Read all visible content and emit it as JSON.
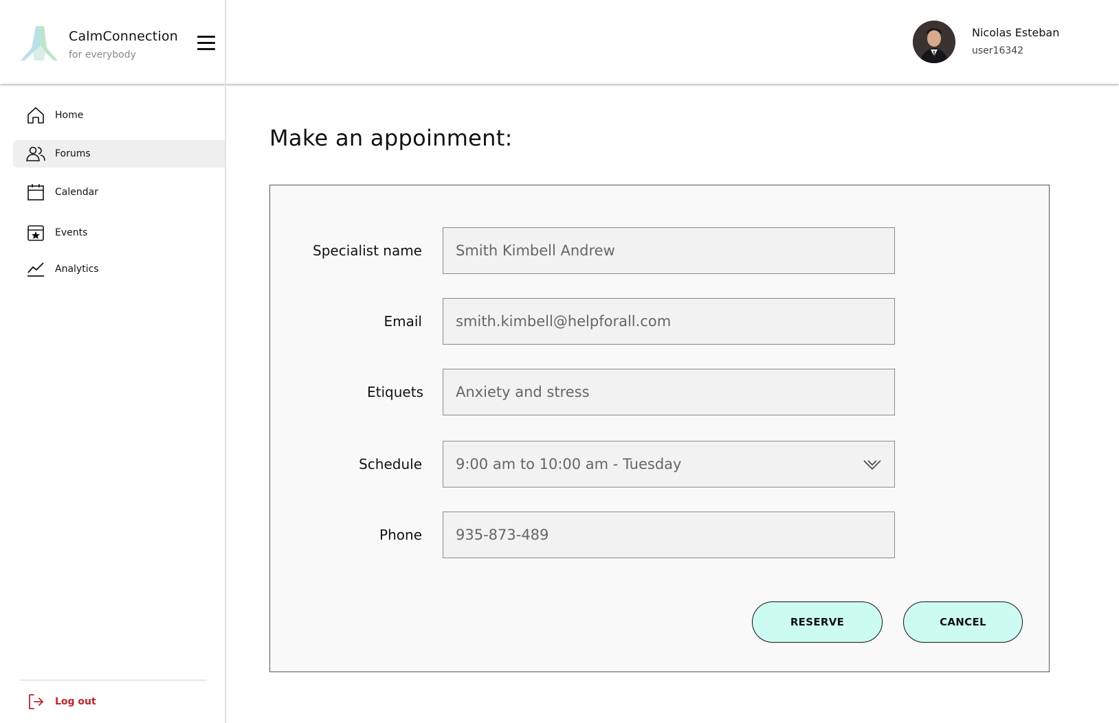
{
  "brand": {
    "name": "CalmConnection",
    "tagline": "for everybody"
  },
  "user": {
    "name": "Nicolas Esteban",
    "id": "user16342"
  },
  "sidebar": {
    "items": [
      {
        "label": "Home",
        "icon": "home-icon"
      },
      {
        "label": "Forums",
        "icon": "users-icon",
        "active": true
      },
      {
        "label": "Calendar",
        "icon": "calendar-icon"
      },
      {
        "label": "Events",
        "icon": "calendar-star-icon"
      },
      {
        "label": "Analytics",
        "icon": "line-chart-icon"
      }
    ],
    "logout": {
      "label": "Log out",
      "icon": "logout-icon",
      "color": "#c8202a"
    }
  },
  "main": {
    "title": "Make an appoinment:",
    "form": {
      "specialist": {
        "label": "Specialist name",
        "value": "Smith Kimbell Andrew"
      },
      "email": {
        "label": "Email",
        "value": "smith.kimbell@helpforall.com"
      },
      "etiquets": {
        "label": "Etiquets",
        "value": "Anxiety and stress"
      },
      "schedule": {
        "label": "Schedule",
        "value": "9:00 am to 10:00 am - Tuesday"
      },
      "phone": {
        "label": "Phone",
        "value": "935-873-489"
      }
    },
    "buttons": {
      "reserve": "RESERVE",
      "cancel": "CANCEL"
    }
  },
  "colors": {
    "button_bg": "#ccfbf1",
    "accent_red": "#c8202a",
    "active_item_bg": "#efefef"
  }
}
